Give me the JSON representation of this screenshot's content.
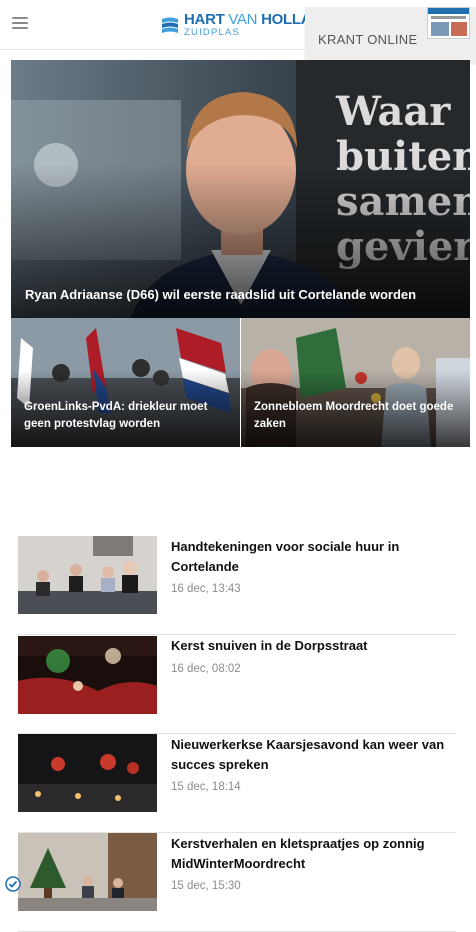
{
  "header": {
    "logo_main_bold": "HART",
    "logo_main_van": "VAN",
    "logo_main_rest": "HOLLAN",
    "logo_sub": "ZUIDPLAS",
    "krant_label": "KRANT ONLINE"
  },
  "hero": {
    "title": "Ryan Adriaanse (D66) wil eerste raadslid uit Cortelande worden",
    "bg_text": [
      "Waar",
      "buiten",
      "samen",
      "gevier"
    ]
  },
  "tiles": [
    {
      "title": "GroenLinks-PvdA: driekleur moet geen protestvlag worden"
    },
    {
      "title": "Zonnebloem Moordrecht doet goede zaken"
    }
  ],
  "articles": [
    {
      "title": "Handtekeningen voor sociale huur in Cortelande",
      "time": "16 dec, 13:43"
    },
    {
      "title": "Kerst snuiven in de Dorpsstraat",
      "time": "16 dec, 08:02"
    },
    {
      "title": "Nieuwerkerkse Kaarsjesavond kan weer van succes spreken",
      "time": "15 dec, 18:14"
    },
    {
      "title": "Kerstverhalen en kletspraatjes op zonnig MidWinterMoordrecht",
      "time": "15 dec, 15:30"
    }
  ],
  "colors": {
    "brand": "#1f6fb2",
    "brand_light": "#3fa0dd"
  },
  "icons": [
    "menu-icon",
    "logo-mark-icon",
    "newspaper-thumbnail",
    "verified-badge-icon"
  ]
}
